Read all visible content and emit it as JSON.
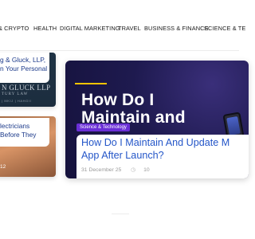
{
  "nav": {
    "items": [
      "& CRYPTO",
      "HEALTH",
      "DIGITAL MARKETING",
      "TRAVEL",
      "BUSINESS & FINANCE",
      "SCIENCE & TE"
    ]
  },
  "card1": {
    "title": "g & Gluck, LLP, n Your Personal",
    "firm_text": "N GLUCK LLP",
    "sub_text": "TURY LAW",
    "sub2_text": "| MKIJ | HAHGII"
  },
  "card2": {
    "title": "lectricians Before They",
    "meta": "12"
  },
  "featured": {
    "image_line1": "How Do I",
    "image_line2": "Maintain and",
    "badge": "Science & Technology",
    "title": "How Do I Maintain And Update M App After Launch?",
    "date": "31 December 25",
    "count": "10"
  },
  "colors": {
    "accent": "#6a2fd6",
    "link_blue": "#2456c8",
    "dark_blue": "#1c3a8a",
    "yellow": "#ffc400"
  }
}
